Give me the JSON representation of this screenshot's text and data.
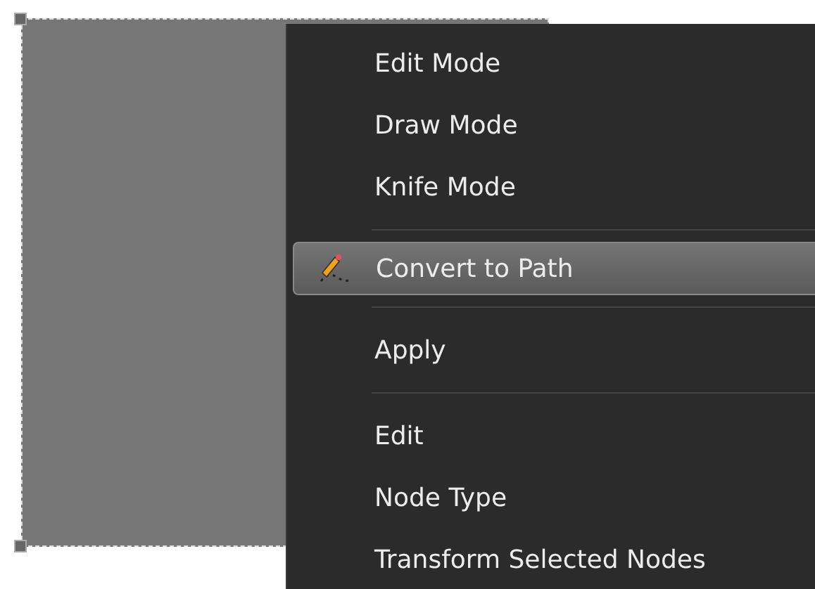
{
  "context_menu": {
    "items": [
      {
        "kind": "item",
        "label": "Edit Mode",
        "selected": false
      },
      {
        "kind": "item",
        "label": "Draw Mode",
        "selected": false
      },
      {
        "kind": "item",
        "label": "Knife Mode",
        "selected": false
      },
      {
        "kind": "separator"
      },
      {
        "kind": "icon_item",
        "label": "Convert to Path",
        "selected": true
      },
      {
        "kind": "separator"
      },
      {
        "kind": "item",
        "label": "Apply",
        "selected": false
      },
      {
        "kind": "separator"
      },
      {
        "kind": "item",
        "label": "Edit",
        "selected": false
      },
      {
        "kind": "item",
        "label": "Node Type",
        "selected": false
      },
      {
        "kind": "item",
        "label": "Transform Selected Nodes",
        "selected": false
      }
    ]
  }
}
